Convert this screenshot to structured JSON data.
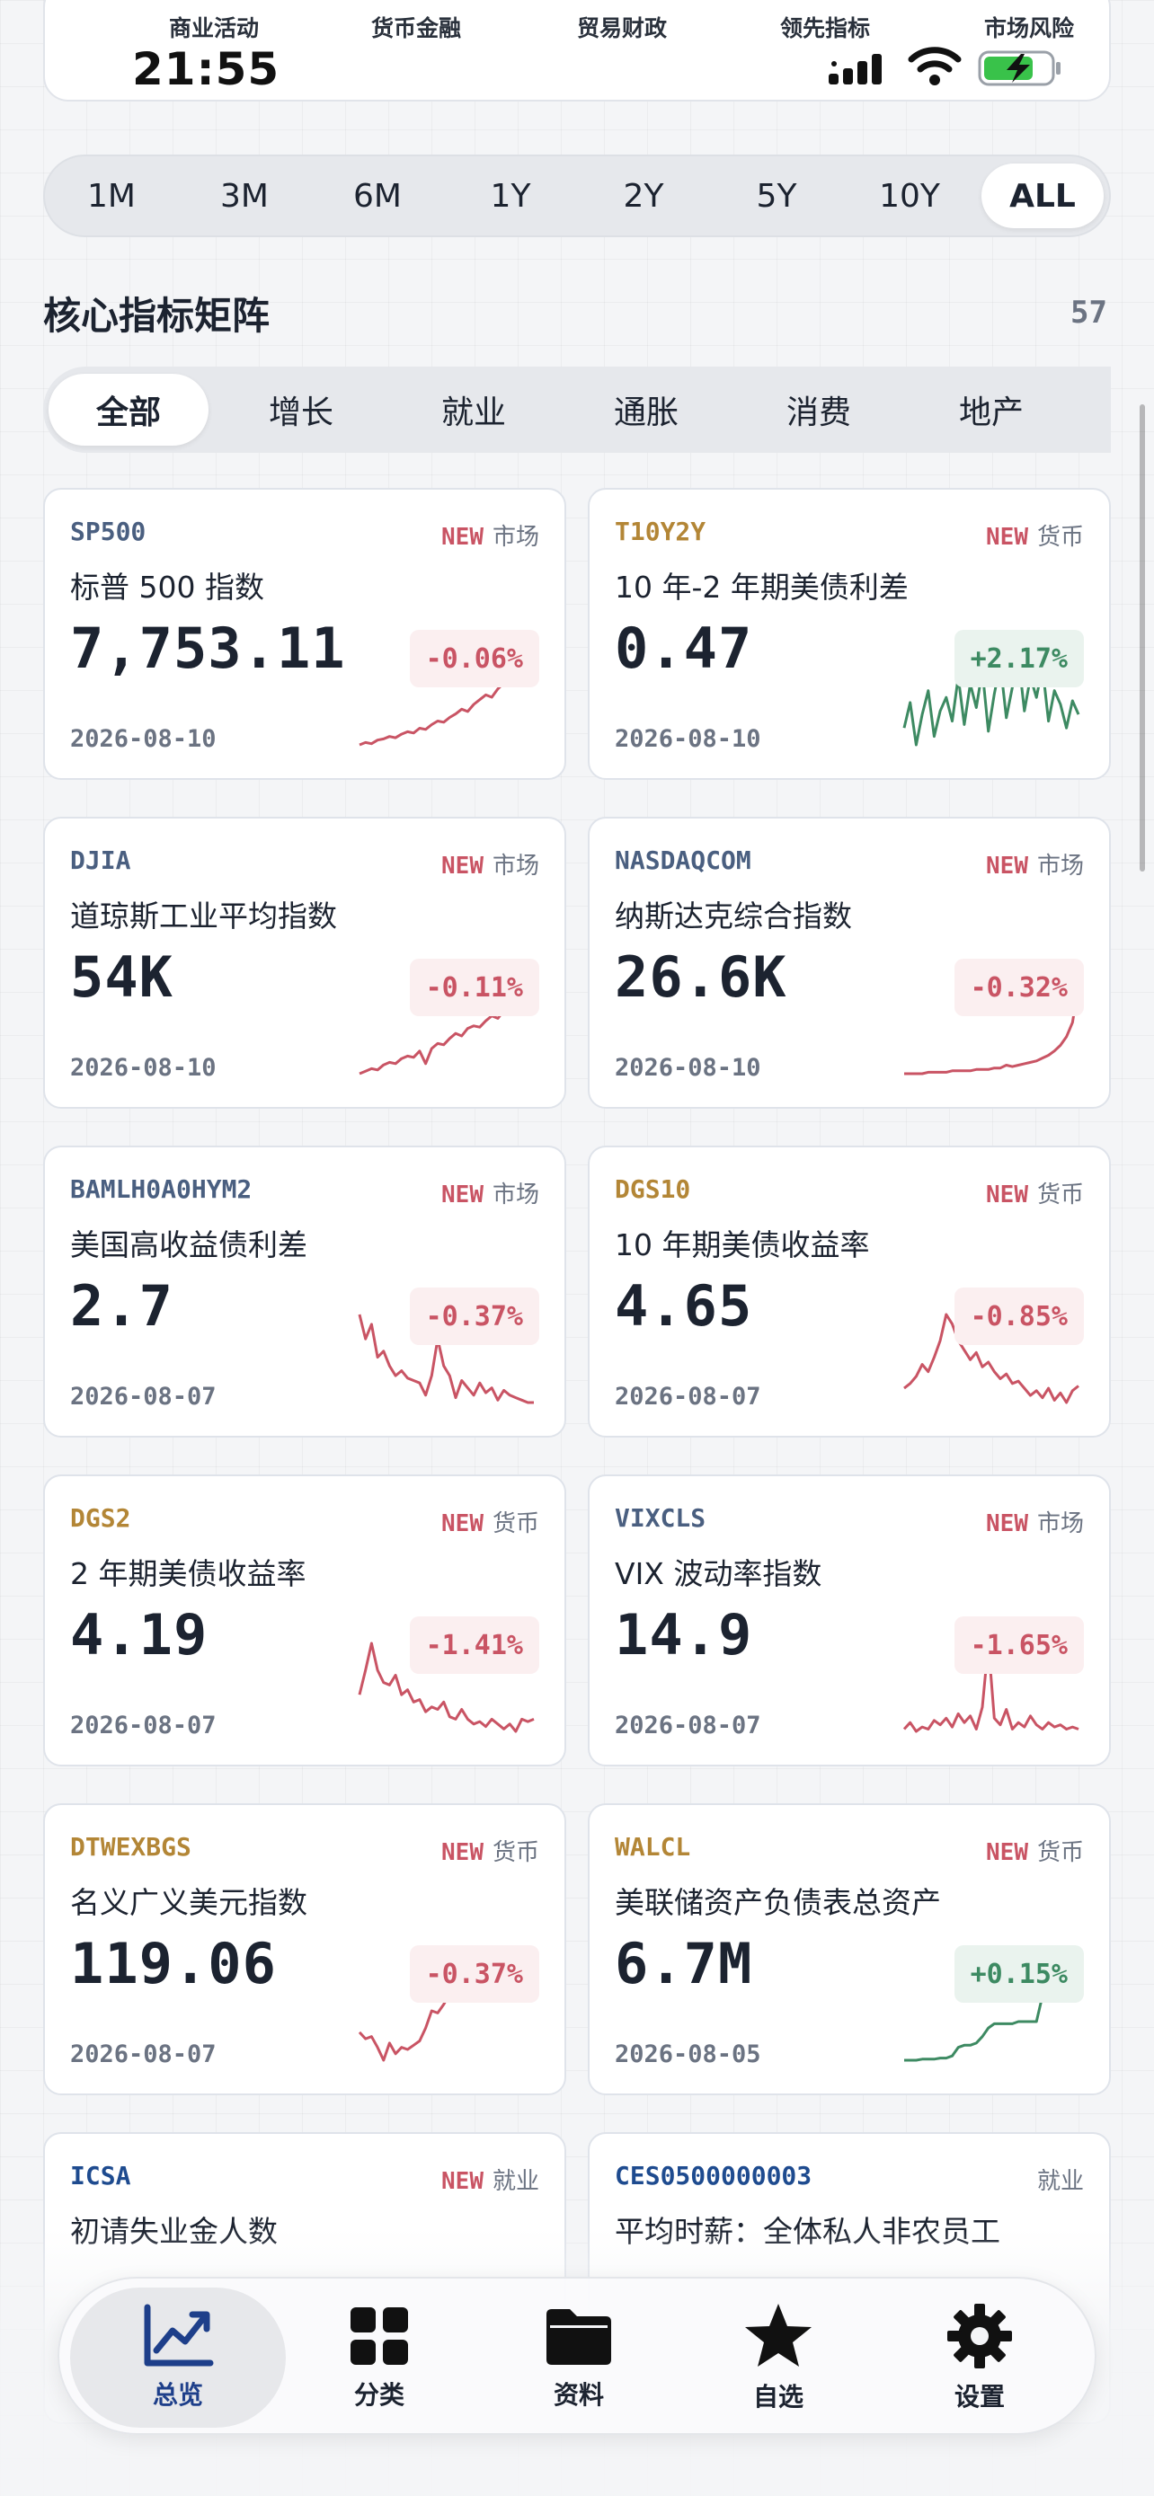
{
  "header": {
    "labels": [
      "商业活动",
      "货币金融",
      "贸易财政",
      "领先指标",
      "市场风险"
    ],
    "time": "21:55"
  },
  "ranges": {
    "items": [
      "1M",
      "3M",
      "6M",
      "1Y",
      "2Y",
      "5Y",
      "10Y",
      "ALL"
    ],
    "active": "ALL"
  },
  "section": {
    "title": "核心指标矩阵",
    "count": "57"
  },
  "categories": {
    "items": [
      "全部",
      "增长",
      "就业",
      "通胀",
      "消费",
      "地产"
    ],
    "active": "全部"
  },
  "colors": {
    "market": "#4a5f80",
    "currency": "#b38636",
    "employment": "#1e4b8f",
    "negative": "#c95464",
    "positive": "#3d8a62"
  },
  "cards": [
    {
      "code": "SP500",
      "code_color": "#4a5f80",
      "is_new": true,
      "new_label": "NEW",
      "category": "市场",
      "name": "标普 500 指数",
      "value": "7,753.11",
      "change": "-0.06%",
      "direction": "neg",
      "date": "2026-08-10",
      "sparkline": [
        10,
        12,
        11,
        14,
        15,
        17,
        16,
        19,
        21,
        20,
        24,
        23,
        27,
        30,
        29,
        33,
        36,
        40,
        38,
        44,
        48,
        52,
        50,
        57,
        62,
        60,
        66,
        72,
        78,
        84
      ]
    },
    {
      "code": "T10Y2Y",
      "code_color": "#b38636",
      "is_new": true,
      "new_label": "NEW",
      "category": "货币",
      "name": "10 年-2 年期美债利差",
      "value": "0.47",
      "change": "+2.17%",
      "direction": "pos",
      "date": "2026-08-10",
      "sparkline": [
        40,
        55,
        30,
        48,
        62,
        35,
        50,
        58,
        44,
        70,
        42,
        66,
        52,
        74,
        38,
        60,
        78,
        46,
        64,
        82,
        50,
        70,
        58,
        76,
        44,
        62,
        54,
        40,
        56,
        48
      ]
    },
    {
      "code": "DJIA",
      "code_color": "#4a5f80",
      "is_new": true,
      "new_label": "NEW",
      "category": "市场",
      "name": "道琼斯工业平均指数",
      "value": "54K",
      "change": "-0.11%",
      "direction": "neg",
      "date": "2026-08-10",
      "sparkline": [
        10,
        12,
        14,
        13,
        17,
        19,
        18,
        22,
        24,
        23,
        28,
        18,
        30,
        34,
        33,
        38,
        42,
        40,
        46,
        48,
        47,
        52,
        56,
        54,
        60,
        64,
        66,
        70,
        74,
        80
      ]
    },
    {
      "code": "NASDAQCOM",
      "code_color": "#4a5f80",
      "is_new": true,
      "new_label": "NEW",
      "category": "市场",
      "name": "纳斯达克综合指数",
      "value": "26.6K",
      "change": "-0.32%",
      "direction": "neg",
      "date": "2026-08-10",
      "sparkline": [
        8,
        8,
        8,
        8,
        9,
        9,
        9,
        9,
        10,
        10,
        10,
        10,
        11,
        11,
        11,
        12,
        12,
        14,
        13,
        14,
        15,
        16,
        17,
        19,
        21,
        24,
        28,
        34,
        44,
        70
      ]
    },
    {
      "code": "BAMLH0A0HYM2",
      "code_color": "#4a5f80",
      "is_new": true,
      "new_label": "NEW",
      "category": "市场",
      "name": "美国高收益债利差",
      "value": "2.7",
      "change": "-0.37%",
      "direction": "neg",
      "date": "2026-08-07",
      "sparkline": [
        90,
        70,
        82,
        55,
        60,
        48,
        40,
        44,
        38,
        36,
        34,
        24,
        40,
        70,
        48,
        40,
        22,
        36,
        30,
        24,
        34,
        26,
        30,
        20,
        28,
        24,
        22,
        20,
        18,
        18
      ]
    },
    {
      "code": "DGS10",
      "code_color": "#b38636",
      "is_new": true,
      "new_label": "NEW",
      "category": "货币",
      "name": "10 年期美债收益率",
      "value": "4.65",
      "change": "-0.85%",
      "direction": "neg",
      "date": "2026-08-07",
      "sparkline": [
        30,
        34,
        40,
        50,
        44,
        56,
        70,
        92,
        84,
        70,
        62,
        54,
        60,
        48,
        52,
        44,
        38,
        42,
        34,
        36,
        30,
        24,
        28,
        22,
        30,
        20,
        26,
        18,
        28,
        32
      ]
    },
    {
      "code": "DGS2",
      "code_color": "#b38636",
      "is_new": true,
      "new_label": "NEW",
      "category": "货币",
      "name": "2 年期美债收益率",
      "value": "4.19",
      "change": "-1.41%",
      "direction": "neg",
      "date": "2026-08-07",
      "sparkline": [
        50,
        70,
        92,
        70,
        60,
        58,
        66,
        50,
        54,
        44,
        46,
        36,
        40,
        38,
        44,
        32,
        30,
        38,
        30,
        26,
        28,
        24,
        30,
        26,
        22,
        26,
        20,
        30,
        28,
        30
      ]
    },
    {
      "code": "VIXCLS",
      "code_color": "#4a5f80",
      "is_new": true,
      "new_label": "NEW",
      "category": "市场",
      "name": "VIX 波动率指数",
      "value": "14.9",
      "change": "-1.65%",
      "direction": "neg",
      "date": "2026-08-07",
      "sparkline": [
        20,
        26,
        18,
        22,
        20,
        28,
        24,
        30,
        22,
        34,
        26,
        32,
        20,
        40,
        98,
        30,
        24,
        38,
        20,
        26,
        22,
        32,
        24,
        20,
        26,
        22,
        24,
        20,
        22,
        20
      ]
    },
    {
      "code": "DTWEXBGS",
      "code_color": "#b38636",
      "is_new": true,
      "new_label": "NEW",
      "category": "货币",
      "name": "名义广义美元指数",
      "value": "119.06",
      "change": "-0.37%",
      "direction": "neg",
      "date": "2026-08-07",
      "sparkline": [
        40,
        34,
        36,
        26,
        14,
        30,
        20,
        26,
        24,
        28,
        32,
        44,
        60,
        58,
        66,
        76,
        72,
        84,
        78,
        86,
        80,
        76,
        88,
        94,
        84,
        90,
        96,
        84,
        86,
        90
      ]
    },
    {
      "code": "WALCL",
      "code_color": "#b38636",
      "is_new": true,
      "new_label": "NEW",
      "category": "货币",
      "name": "美联储资产负债表总资产",
      "value": "6.7M",
      "change": "+0.15%",
      "direction": "pos",
      "date": "2026-08-05",
      "sparkline": [
        10,
        10,
        10,
        11,
        11,
        11,
        12,
        12,
        14,
        22,
        24,
        24,
        26,
        32,
        40,
        44,
        44,
        44,
        44,
        46,
        46,
        46,
        46,
        70,
        92,
        88,
        80,
        74,
        68,
        70
      ]
    },
    {
      "code": "ICSA",
      "code_color": "#1e4b8f",
      "is_new": true,
      "new_label": "NEW",
      "category": "就业",
      "name": "初请失业金人数",
      "value": "",
      "change": "",
      "direction": "neg",
      "date": "",
      "sparkline": []
    },
    {
      "code": "CES0500000003",
      "code_color": "#1e4b8f",
      "is_new": false,
      "new_label": "",
      "category": "就业",
      "name": "平均时薪：全体私人非农员工",
      "value": "",
      "change": "",
      "direction": "pos",
      "date": "",
      "sparkline": []
    }
  ],
  "nav": {
    "items": [
      {
        "label": "总览",
        "icon": "chart-line-icon"
      },
      {
        "label": "分类",
        "icon": "grid-icon"
      },
      {
        "label": "资料",
        "icon": "folder-icon"
      },
      {
        "label": "自选",
        "icon": "star-icon"
      },
      {
        "label": "设置",
        "icon": "gear-icon"
      }
    ],
    "active": "总览"
  }
}
